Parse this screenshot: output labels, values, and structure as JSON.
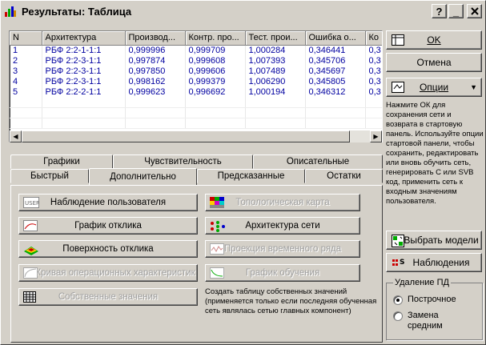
{
  "window": {
    "title": "Результаты: Таблица"
  },
  "titlebar_buttons": {
    "help": "?",
    "minimize": "_",
    "close": "X"
  },
  "grid": {
    "columns": [
      "N",
      "Архитектура",
      "Производ...",
      "Контр. про...",
      "Тест. прои...",
      "Ошибка о...",
      "Ко"
    ],
    "rows": [
      [
        "1",
        "РБФ 2:2-1-1:1",
        "0,999996",
        "0,999709",
        "1,000284",
        "0,346441",
        "0,3"
      ],
      [
        "2",
        "РБФ 2:2-3-1:1",
        "0,997874",
        "0,999608",
        "1,007393",
        "0,345706",
        "0,3"
      ],
      [
        "3",
        "РБФ 2:2-3-1:1",
        "0,997850",
        "0,999606",
        "1,007489",
        "0,345697",
        "0,3"
      ],
      [
        "4",
        "РБФ 2:2-3-1:1",
        "0,998162",
        "0,999379",
        "1,006290",
        "0,345805",
        "0,3"
      ],
      [
        "5",
        "РБФ 2:2-2-1:1",
        "0,999623",
        "0,996692",
        "1,000194",
        "0,346312",
        "0,3"
      ]
    ]
  },
  "right": {
    "ok": "OK",
    "cancel": "Отмена",
    "options": "Опции",
    "help_text": "Нажмите ОК для сохранения сети и возврата в стартовую панель. Используйте опции стартовой панели, чтобы сохранить, редактировать или вновь обучить сеть, генерировать С или SVB код, применить сеть к входным значениям пользователя.",
    "select_models": "Выбрать модели",
    "observations": "Наблюдения",
    "delete_group": "Удаление ПД",
    "radio_row": "Построчное",
    "radio_replace": "Замена средним"
  },
  "tabs": {
    "row1": [
      "Графики",
      "Чувствительность",
      "Описательные"
    ],
    "row2": [
      "Быстрый",
      "Дополнительно",
      "Предсказанные",
      "Остатки"
    ],
    "active": "Дополнительно"
  },
  "panel": {
    "user_obs": "Наблюдение пользователя",
    "response_graph": "График отклика",
    "response_surface": "Поверхность отклика",
    "roc_curve": "Кривая операционных характеристик",
    "eigenvalues": "Собственные значения",
    "topo_map": "Топологическая карта",
    "net_arch": "Архитектура сети",
    "ts_projection": "Проекция временного ряда",
    "training_graph": "График обучения",
    "eigen_desc": "Создать таблицу собственных значений (применяется только если последняя обученная сеть являлась сетью главных компонент)"
  },
  "colors": {
    "data_text": "#0000a0",
    "face": "#d4d0c8"
  }
}
